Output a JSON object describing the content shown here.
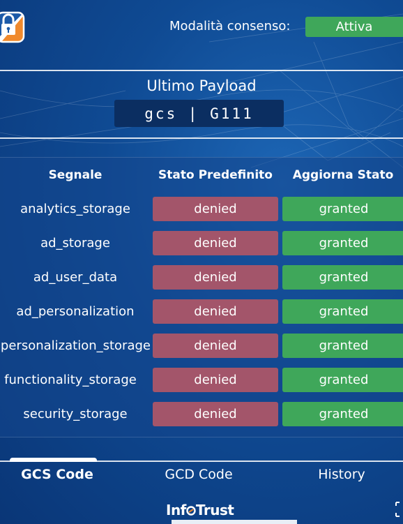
{
  "header": {
    "consent_label": "Modalità consenso:",
    "consent_status": "Attiva"
  },
  "payload": {
    "title": "Ultimo Payload",
    "value": "gcs | G111"
  },
  "table": {
    "headers": [
      "Segnale",
      "Stato Predefinito",
      "Aggiorna Stato"
    ],
    "rows": [
      {
        "signal": "analytics_storage",
        "default": "denied",
        "update": "granted"
      },
      {
        "signal": "ad_storage",
        "default": "denied",
        "update": "granted"
      },
      {
        "signal": "ad_user_data",
        "default": "denied",
        "update": "granted"
      },
      {
        "signal": "ad_personalization",
        "default": "denied",
        "update": "granted"
      },
      {
        "signal": "personalization_storage",
        "default": "denied",
        "update": "granted"
      },
      {
        "signal": "functionality_storage",
        "default": "denied",
        "update": "granted"
      },
      {
        "signal": "security_storage",
        "default": "denied",
        "update": "granted"
      }
    ]
  },
  "tabs": [
    {
      "label": "GCS Code",
      "active": true
    },
    {
      "label": "GCD Code",
      "active": false
    },
    {
      "label": "History",
      "active": false
    }
  ],
  "footer": {
    "brand_prefix": "Inf",
    "brand_suffix": "Trust"
  },
  "colors": {
    "granted": "#3fa75a",
    "denied": "#a3556a",
    "background": "#0f4a93"
  },
  "icons": {
    "logo": "lock-shield-icon",
    "corner": "expand-icon"
  }
}
